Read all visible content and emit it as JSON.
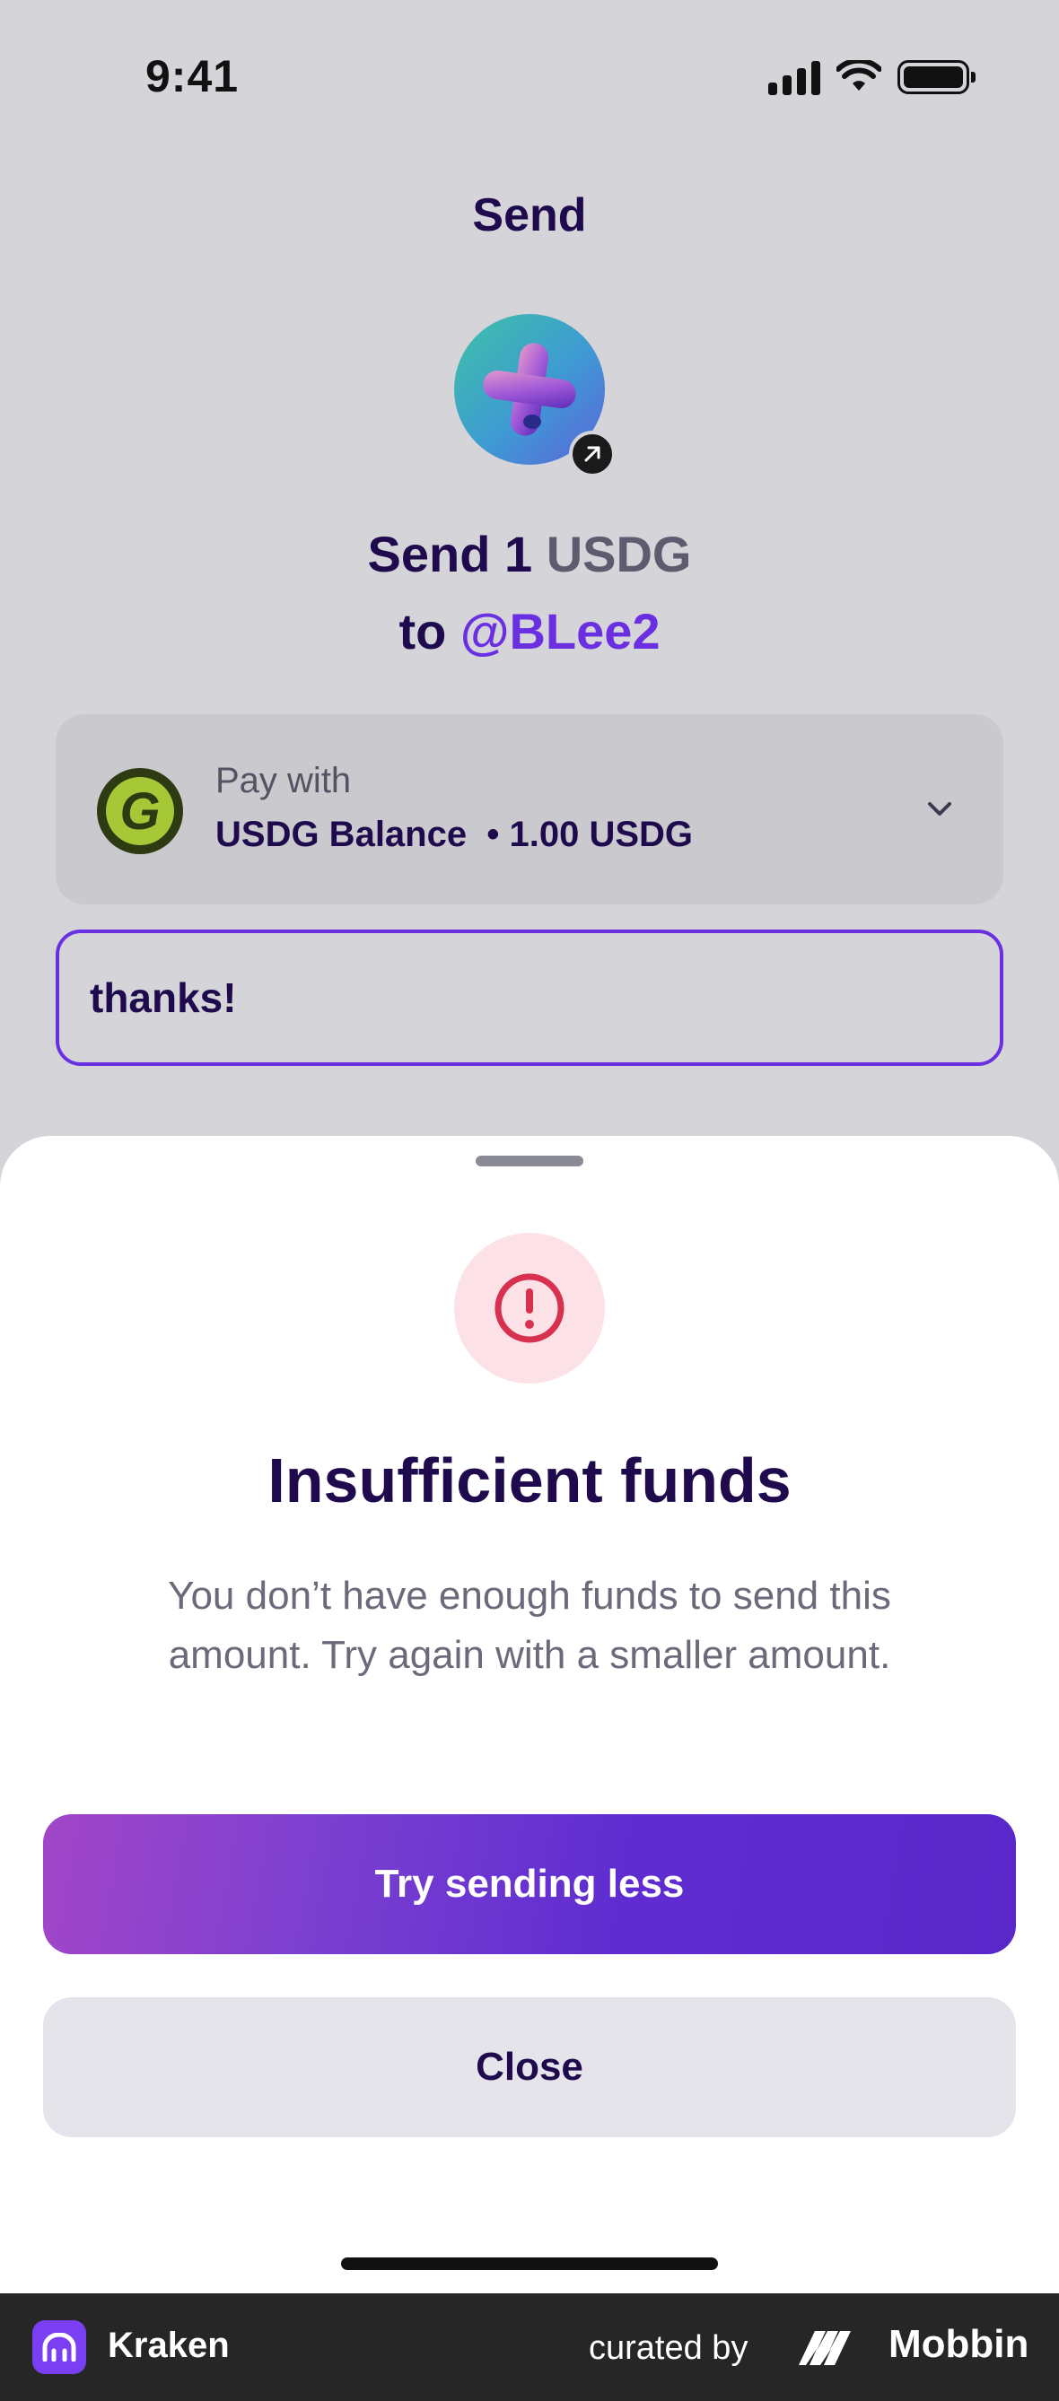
{
  "status_bar": {
    "time": "9:41"
  },
  "header": {
    "title": "Send"
  },
  "headline": {
    "line1_prefix": "Send 1",
    "line1_currency": "USDG",
    "line2_prefix": "to",
    "recipient": "@BLee2"
  },
  "pay_with": {
    "label": "Pay with",
    "source": "USDG Balance",
    "separator": "•",
    "amount": "1.00 USDG",
    "coin_glyph": "G"
  },
  "note": {
    "value": "thanks!"
  },
  "sheet": {
    "title": "Insufficient funds",
    "message": "You don’t have enough funds to send this amount. Try again with a smaller amount.",
    "primary_label": "Try sending less",
    "secondary_label": "Close"
  },
  "footer": {
    "app_name": "Kraken",
    "curated_by": "curated by",
    "brand": "Mobbin"
  },
  "colors": {
    "accent": "#6a2fe0",
    "title": "#1f0a4d",
    "alert": "#d8304f"
  }
}
